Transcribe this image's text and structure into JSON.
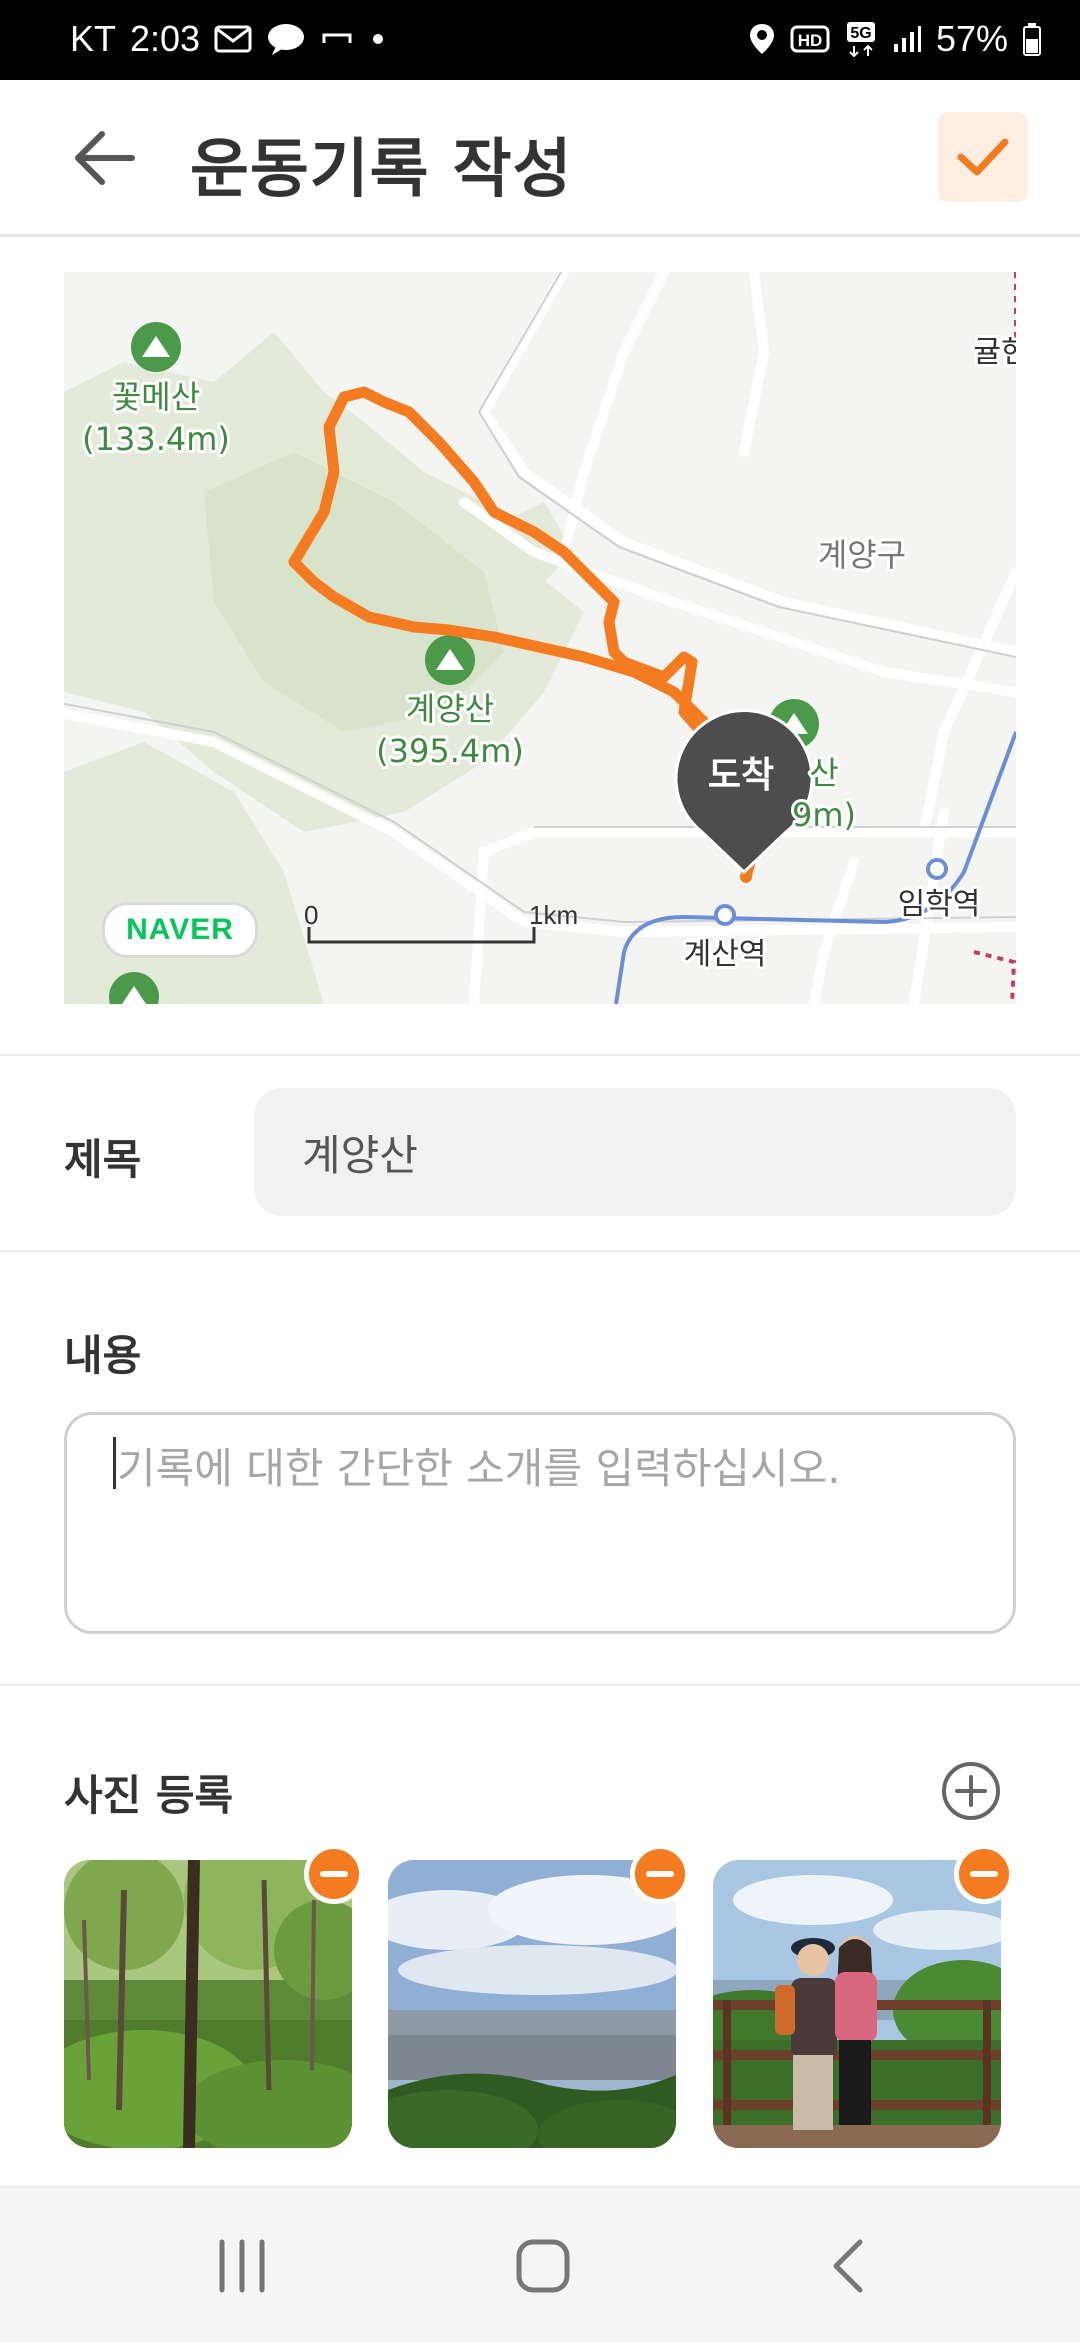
{
  "status_bar": {
    "carrier": "KT",
    "time": "2:03",
    "network": "5G",
    "hd": "HD",
    "battery": "57%",
    "icons": [
      "mail-icon",
      "chat-icon",
      "dot-icon",
      "location-icon",
      "signal-icon",
      "battery-icon"
    ]
  },
  "header": {
    "title": "운동기록 작성",
    "back_icon": "back-arrow-icon",
    "confirm_icon": "check-icon"
  },
  "map": {
    "labels": {
      "mountain1_name": "꽃메산",
      "mountain1_height": "(133.4m)",
      "mountain2_name": "계양산",
      "mountain2_height": "(395.4m)",
      "mountain3_name": "산",
      "mountain3_height": "9m)",
      "district": "계양구",
      "edge_label": "귤현",
      "station1": "계산역",
      "station2": "임학역"
    },
    "marker_label": "도착",
    "scale_start": "0",
    "scale_end": "1km",
    "logo": "NAVER",
    "route_color": "#f47b20"
  },
  "form": {
    "title_label": "제목",
    "title_value": "계양산",
    "content_label": "내용",
    "content_placeholder": "기록에 대한 간단한 소개를 입력하십시오.",
    "photo_label": "사진 등록"
  },
  "photos": [
    {
      "scene": "forest",
      "remove_icon": "minus-icon"
    },
    {
      "scene": "city-view",
      "remove_icon": "minus-icon"
    },
    {
      "scene": "two-hikers",
      "remove_icon": "minus-icon"
    }
  ],
  "nav": {
    "recents_icon": "recents-icon",
    "home_icon": "home-icon",
    "back_icon": "nav-back-icon"
  },
  "colors": {
    "accent": "#f47b20",
    "accent_light": "#fdeee3",
    "map_green": "#4a9a4a",
    "metro_line": "#6b8fd6"
  }
}
